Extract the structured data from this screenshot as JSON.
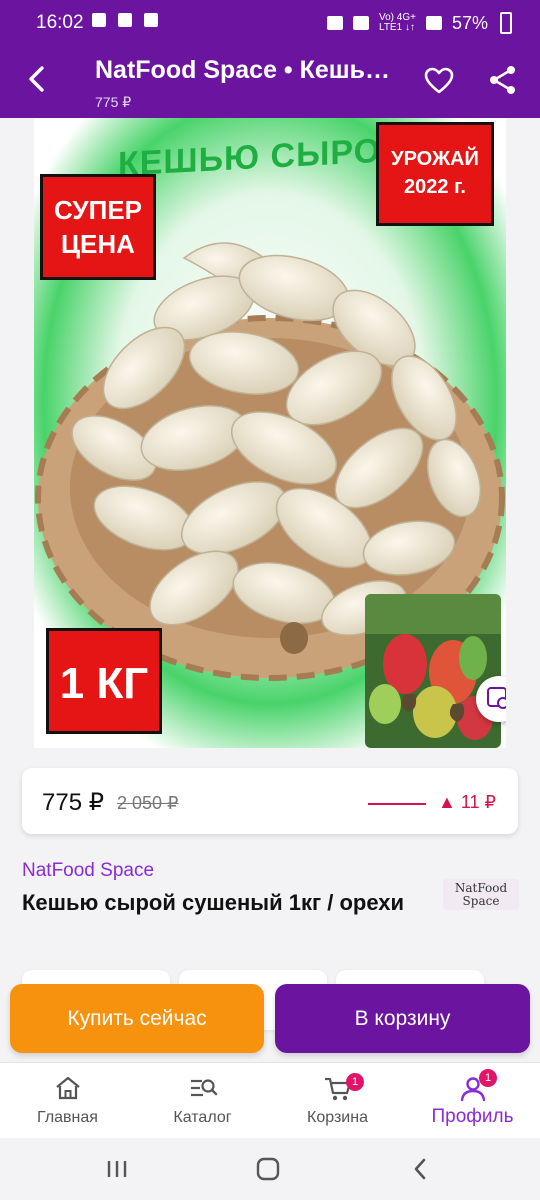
{
  "status_bar": {
    "time": "16:02",
    "net_label": "Vo) 4G+\nLTE1 ↓↑",
    "battery": "57%"
  },
  "header": {
    "title": "NatFood Space • Кешью сырой сушеный 1кг / орехи",
    "subtitle_price": "775 ₽",
    "background_color": "#6a14a0"
  },
  "product_image": {
    "headline": "КЕШЬЮ СЫРОЙ",
    "badge_price": "СУПЕР ЦЕНА",
    "badge_harvest": "УРОЖАЙ 2022 г.",
    "badge_weight": "1 КГ"
  },
  "price_card": {
    "price": "775 ₽",
    "old_price": "2 050 ₽",
    "trend": "▲ 11 ₽",
    "trend_color": "#d6134c"
  },
  "product": {
    "seller": "NatFood Space",
    "name": "Кешью сырой сушеный 1кг / орехи",
    "logo_line1": "NatFood",
    "logo_line2": "Space"
  },
  "actions": {
    "buy_now": "Купить сейчас",
    "add_to_cart": "В корзину",
    "buy_color": "#f7920f",
    "cart_color": "#6a14a0"
  },
  "bottom_nav": {
    "items": [
      {
        "label": "Главная",
        "icon": "home-icon"
      },
      {
        "label": "Каталог",
        "icon": "catalog-search-icon"
      },
      {
        "label": "Корзина",
        "icon": "cart-icon",
        "badge": "1"
      },
      {
        "label": "Профиль",
        "icon": "profile-icon",
        "badge": "1",
        "active": true
      }
    ]
  }
}
